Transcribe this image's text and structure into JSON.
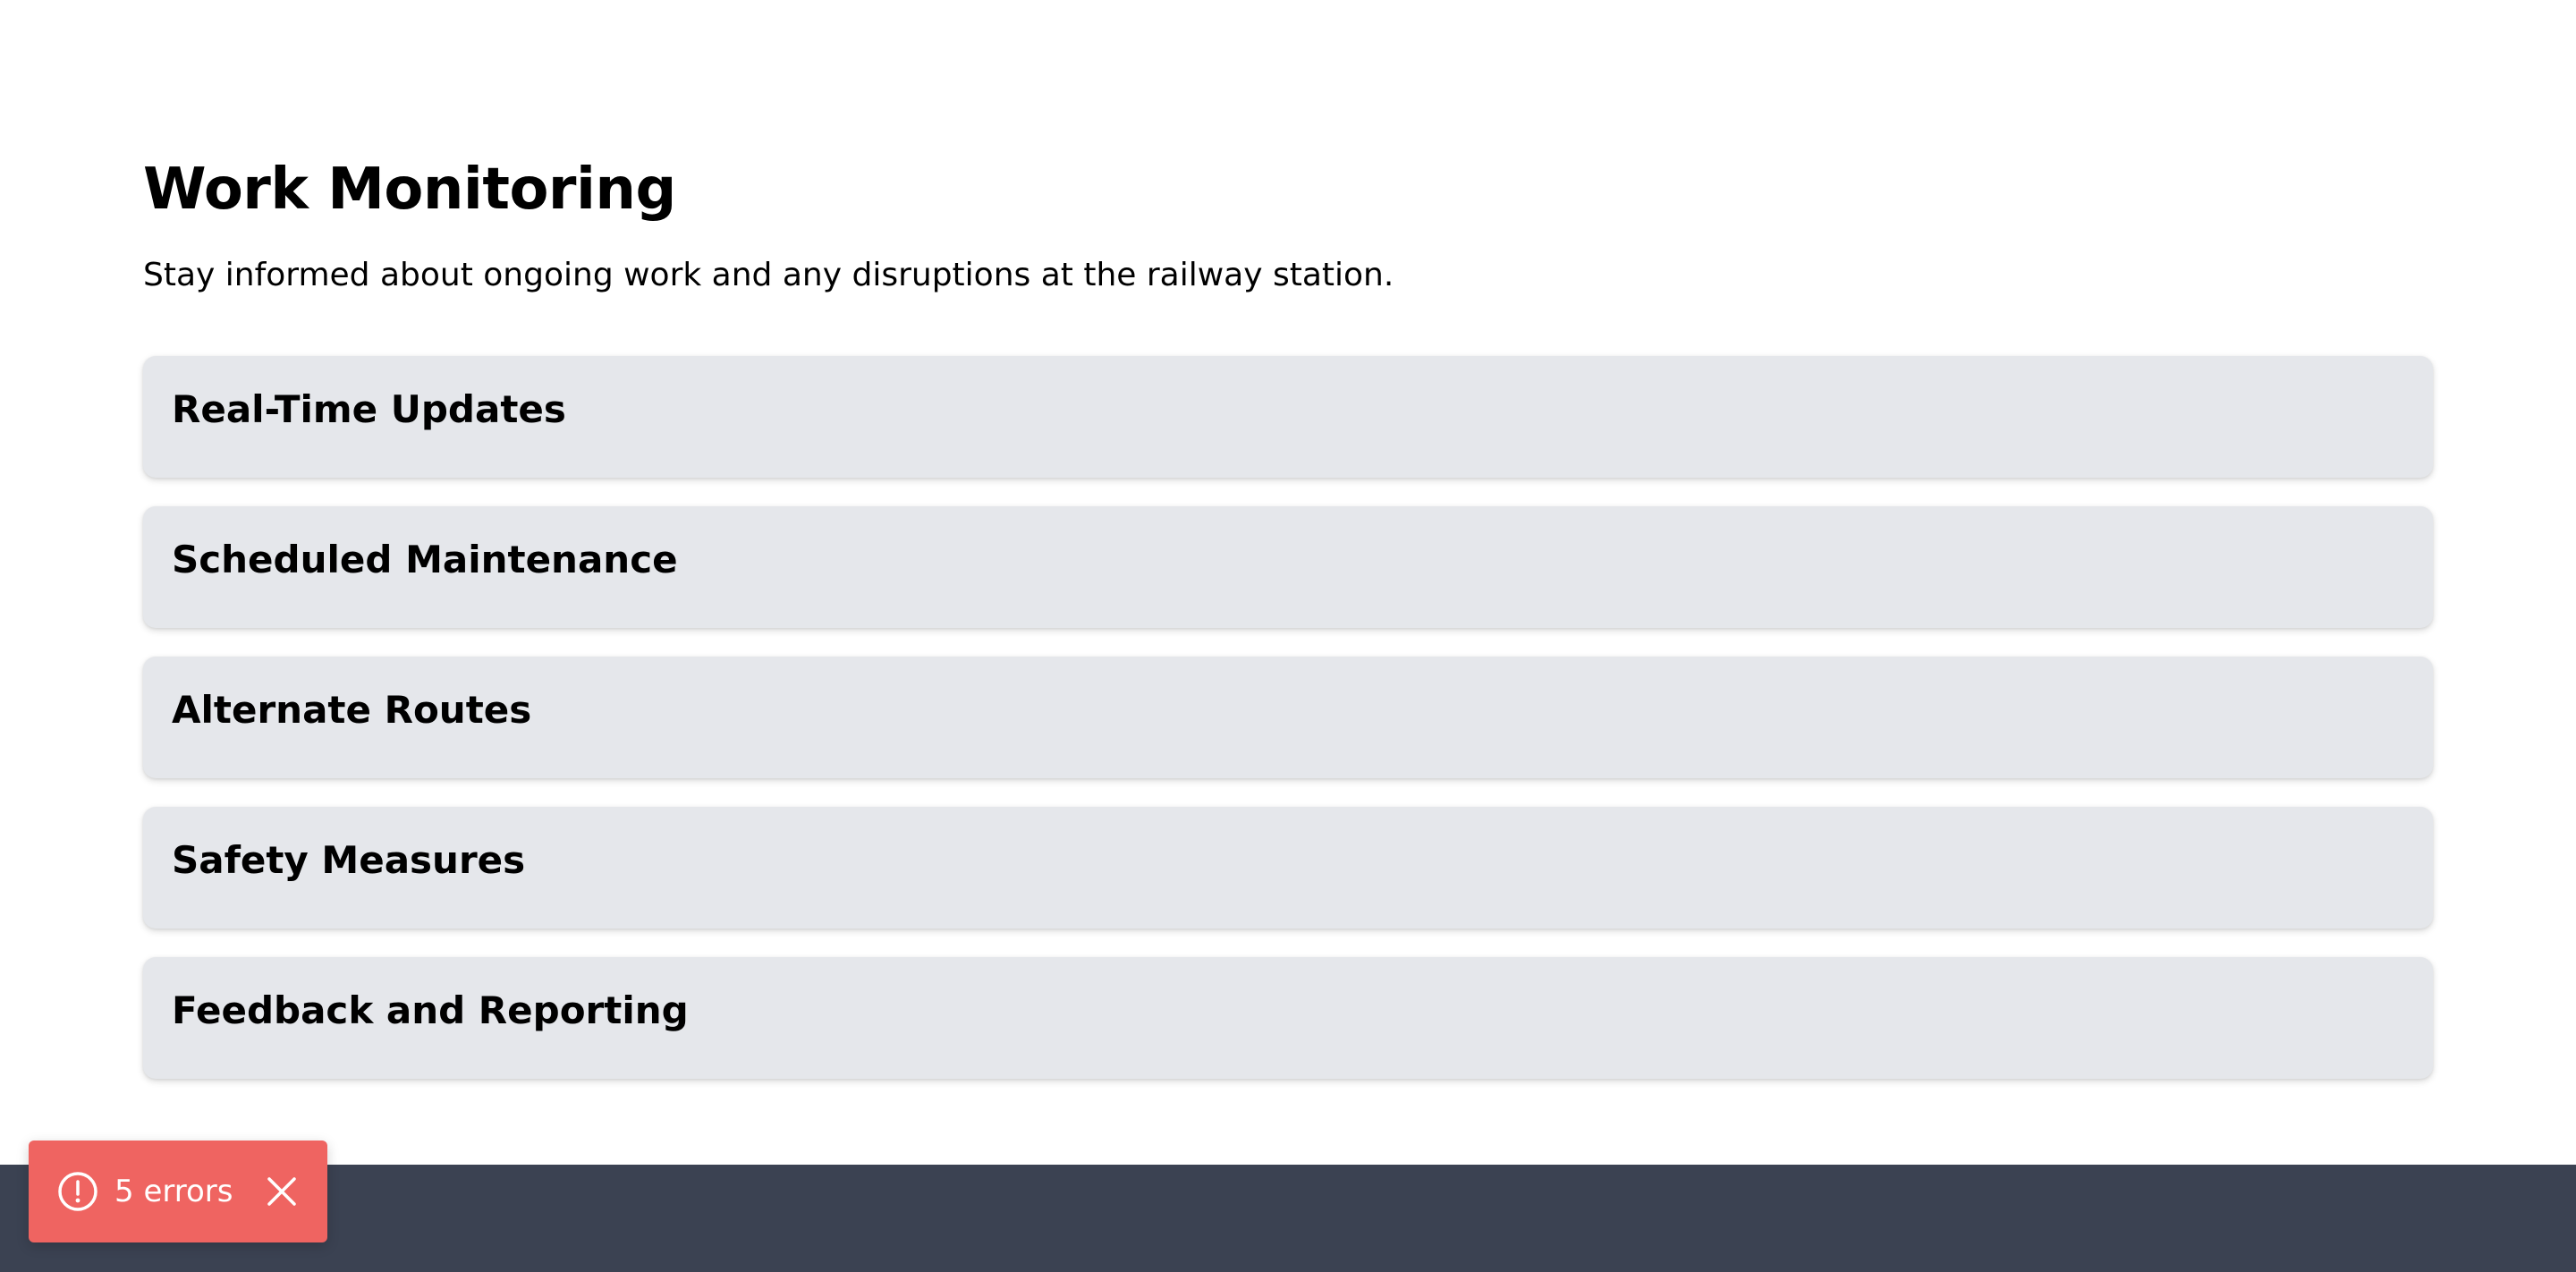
{
  "header": {
    "title": "Work Monitoring",
    "subtitle": "Stay informed about ongoing work and any disruptions at the railway station."
  },
  "sections": [
    {
      "title": "Real-Time Updates"
    },
    {
      "title": "Scheduled Maintenance"
    },
    {
      "title": "Alternate Routes"
    },
    {
      "title": "Safety Measures"
    },
    {
      "title": "Feedback and Reporting"
    }
  ],
  "error_toast": {
    "label": "5 errors",
    "icon": "alert-circle-icon",
    "close_icon": "close-icon",
    "color": "#ef6461"
  },
  "footer": {
    "color": "#3b4252"
  }
}
